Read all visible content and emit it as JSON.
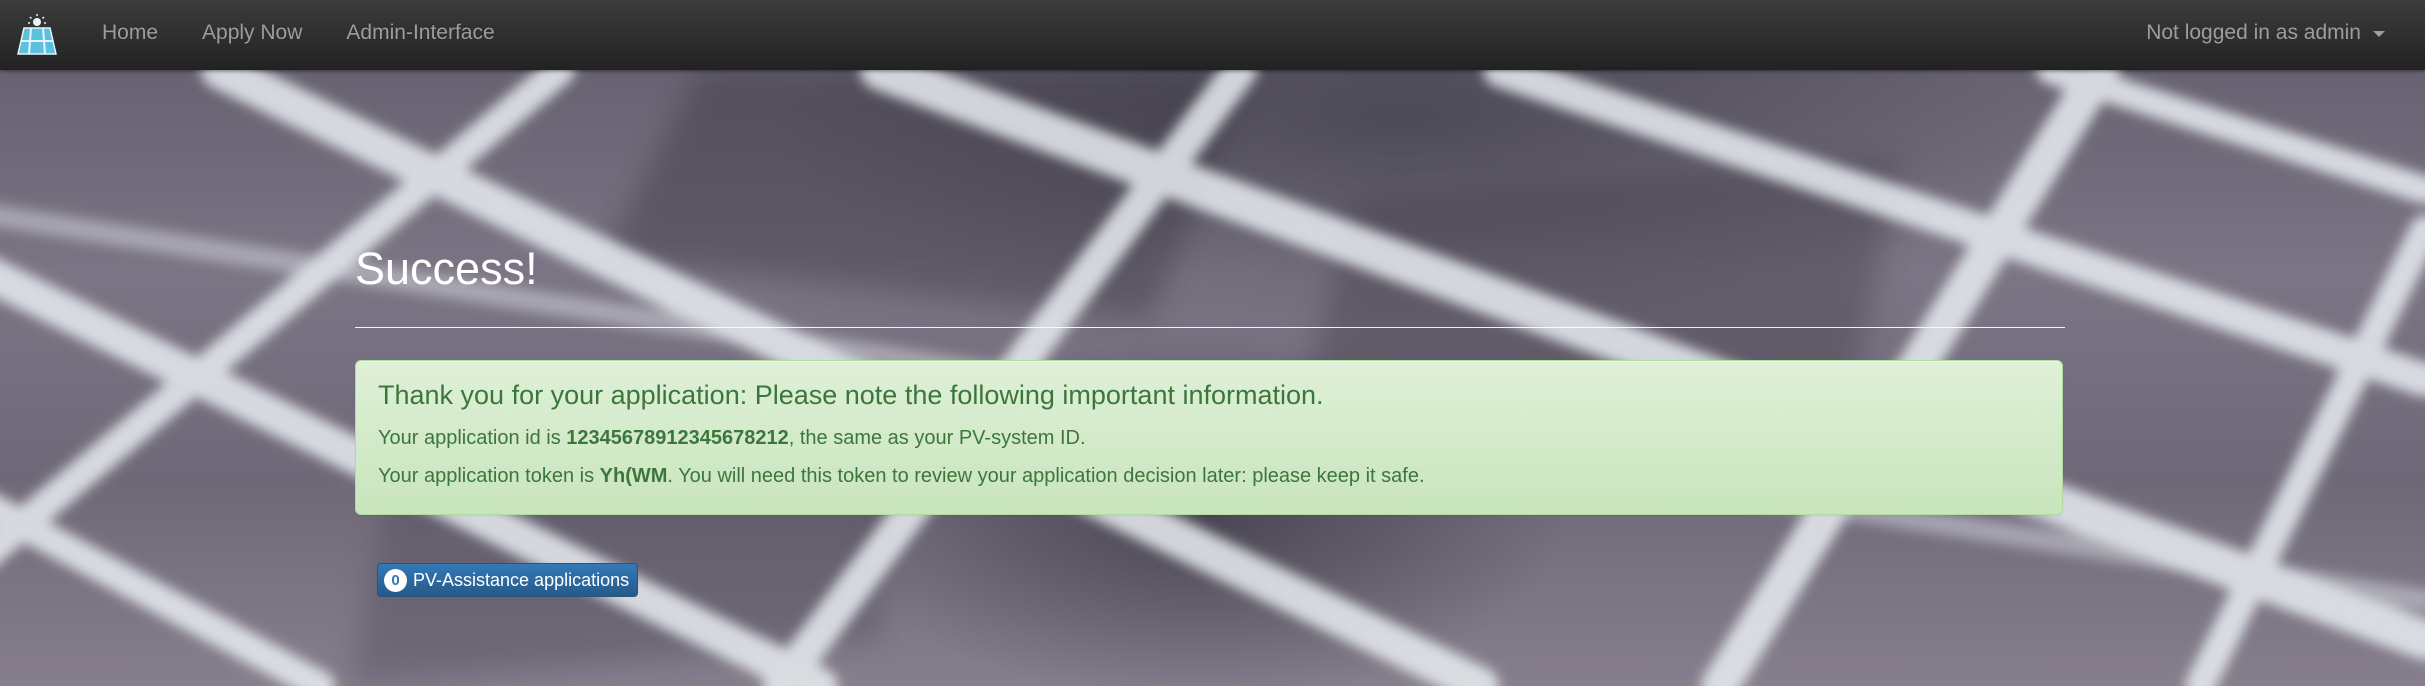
{
  "navbar": {
    "brand_icon": "solar-panel-logo-icon",
    "links": [
      {
        "label": "Home"
      },
      {
        "label": "Apply Now"
      },
      {
        "label": "Admin-Interface"
      }
    ],
    "user_menu_label": "Not logged in as admin"
  },
  "main": {
    "title": "Success!",
    "alert": {
      "heading": "Thank you for your application: Please note the following important information.",
      "id_prefix": "Your application id is ",
      "application_id": "12345678912345678212",
      "id_suffix": ", the same as your PV-system ID.",
      "token_prefix": "Your application token is ",
      "token": "Yh(WM",
      "token_suffix": ". You will need this token to review your application decision later: please keep it safe."
    },
    "applications_button": {
      "count": "0",
      "label": "PV-Assistance applications"
    }
  },
  "colors": {
    "navbar": "#222222",
    "alert_bg": "#dff0d8",
    "alert_text": "#3c763d",
    "button_primary": "#337ab7"
  }
}
